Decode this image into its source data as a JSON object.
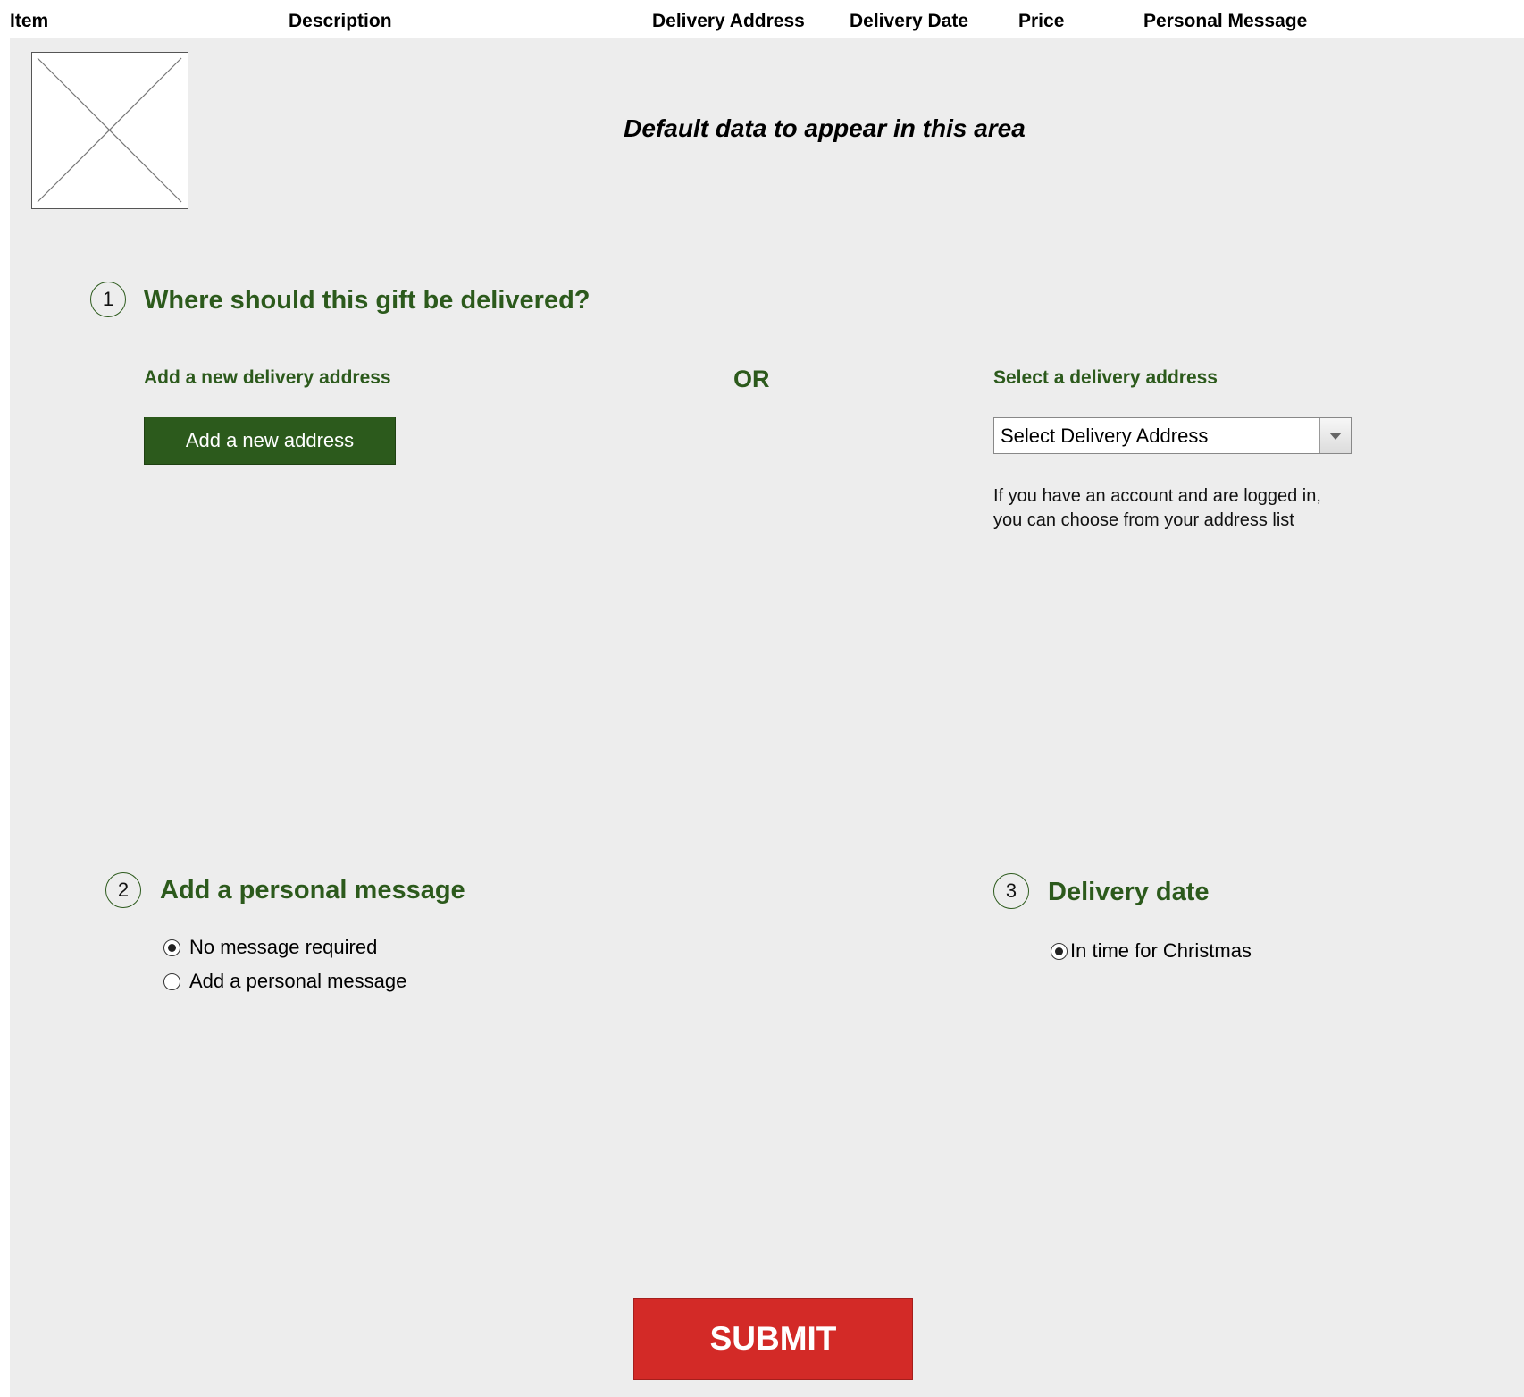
{
  "table_header": {
    "item": "Item",
    "description": "Description",
    "delivery_address": "Delivery Address",
    "delivery_date": "Delivery Date",
    "price": "Price",
    "personal_message": "Personal Message"
  },
  "item_row": {
    "image_icon": "image-placeholder-icon",
    "default_text": "Default data to appear in this area"
  },
  "step1": {
    "number": "1",
    "title": "Where should this gift be delivered?",
    "add_label": "Add a new delivery address",
    "add_button": "Add a new address",
    "or_text": "OR",
    "select_label": "Select a delivery address",
    "select_value": "Select Delivery Address",
    "hint_line1": "If you have an account and are logged in,",
    "hint_line2": "you can choose from your address list"
  },
  "step2": {
    "number": "2",
    "title": "Add a personal message",
    "options": [
      {
        "label": "No message required",
        "checked": true
      },
      {
        "label": "Add a personal message",
        "checked": false
      }
    ]
  },
  "step3": {
    "number": "3",
    "title": "Delivery date",
    "options": [
      {
        "label": "In time for Christmas",
        "checked": true
      }
    ]
  },
  "submit": {
    "label": "SUBMIT"
  },
  "colors": {
    "accent_green": "#2c5a1c",
    "submit_red": "#d32a27",
    "panel_bg": "#ededed"
  }
}
